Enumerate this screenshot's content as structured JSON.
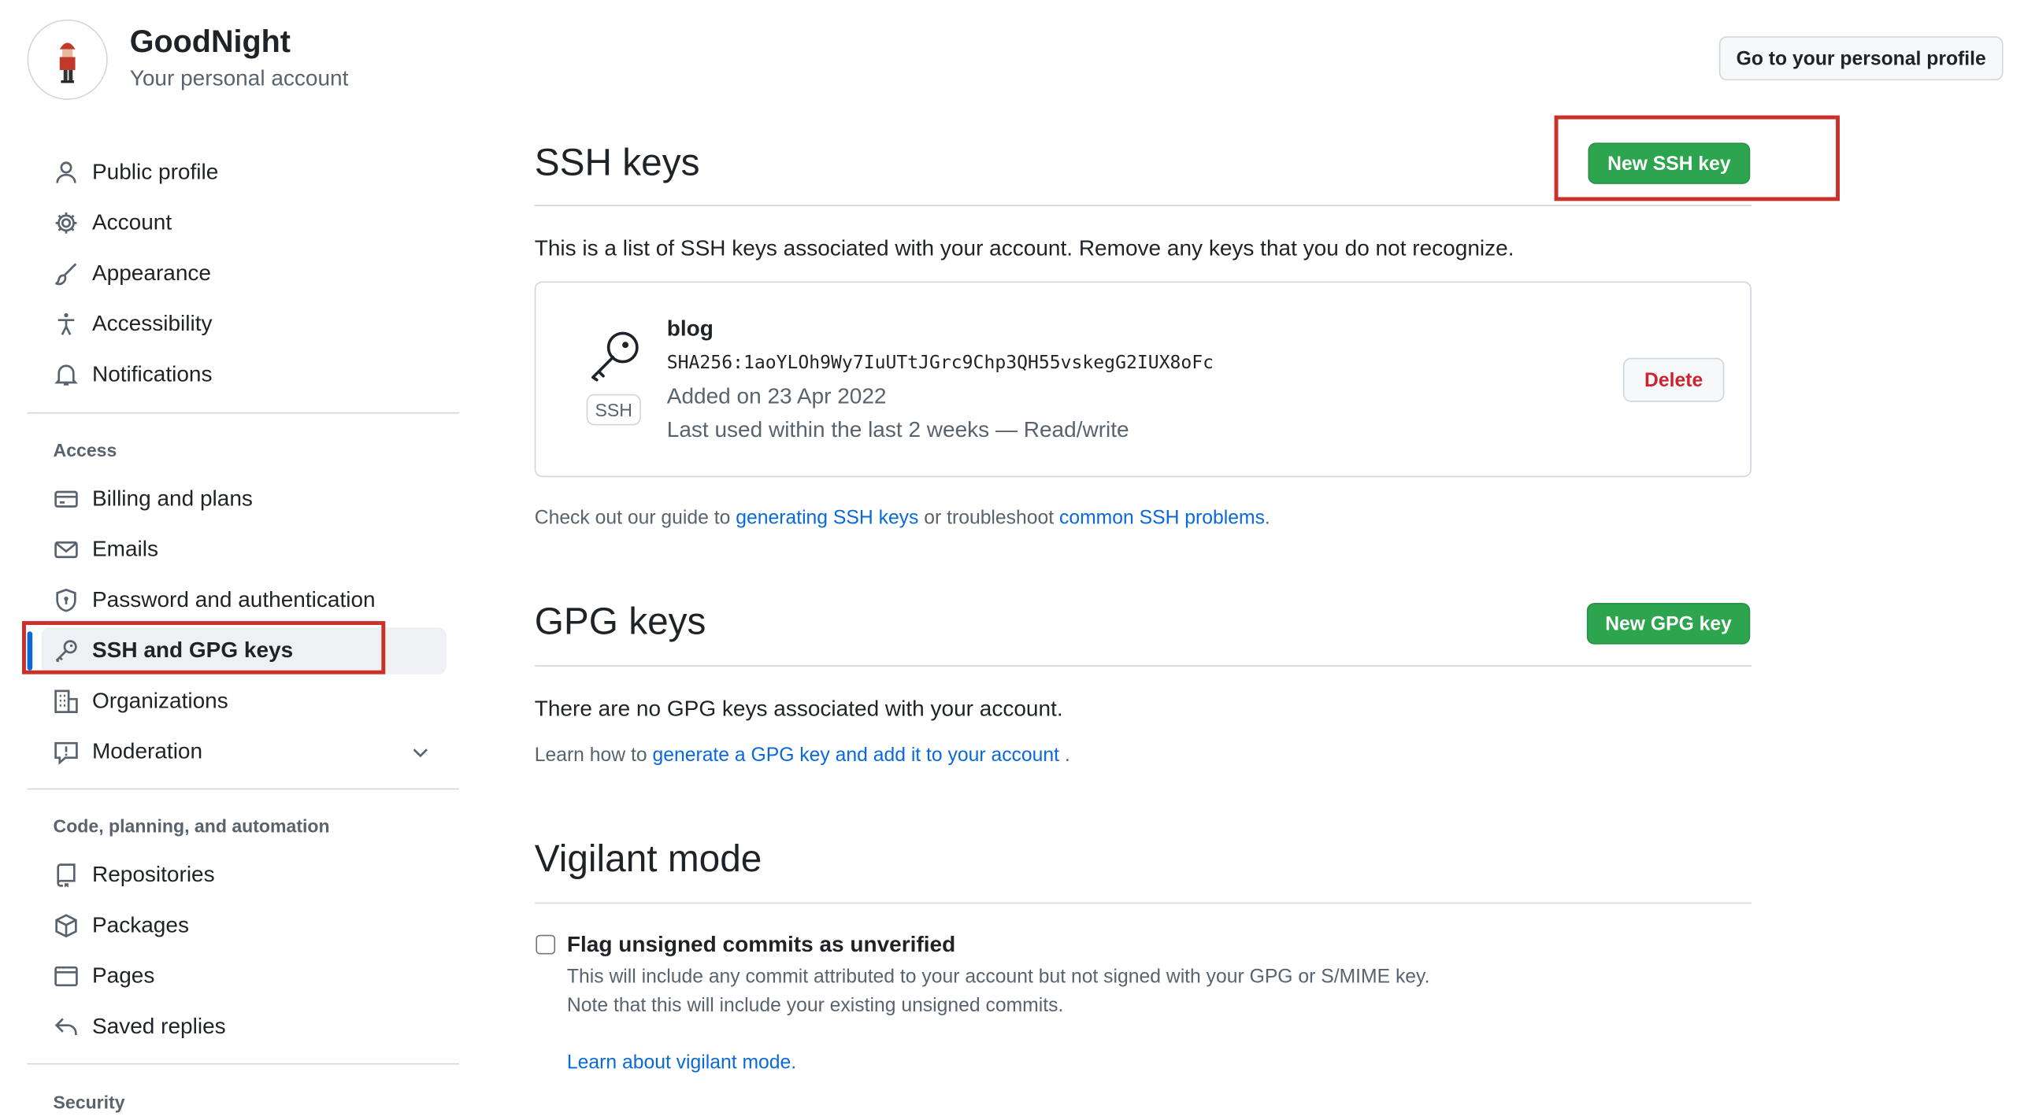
{
  "header": {
    "account_name": "GoodNight",
    "account_subtitle": "Your personal account",
    "profile_button": "Go to your personal profile"
  },
  "sidebar": {
    "items_top": [
      {
        "label": "Public profile",
        "icon": "person-icon"
      },
      {
        "label": "Account",
        "icon": "gear-icon"
      },
      {
        "label": "Appearance",
        "icon": "paintbrush-icon"
      },
      {
        "label": "Accessibility",
        "icon": "accessibility-icon"
      },
      {
        "label": "Notifications",
        "icon": "bell-icon"
      }
    ],
    "access_heading": "Access",
    "items_access": [
      {
        "label": "Billing and plans",
        "icon": "credit-card-icon"
      },
      {
        "label": "Emails",
        "icon": "mail-icon"
      },
      {
        "label": "Password and authentication",
        "icon": "shield-lock-icon"
      },
      {
        "label": "SSH and GPG keys",
        "icon": "key-icon",
        "active": true
      },
      {
        "label": "Organizations",
        "icon": "organization-icon"
      },
      {
        "label": "Moderation",
        "icon": "report-icon",
        "expandable": true
      }
    ],
    "code_heading": "Code, planning, and automation",
    "items_code": [
      {
        "label": "Repositories",
        "icon": "repo-icon"
      },
      {
        "label": "Packages",
        "icon": "package-icon"
      },
      {
        "label": "Pages",
        "icon": "browser-icon"
      },
      {
        "label": "Saved replies",
        "icon": "reply-icon"
      }
    ],
    "security_heading": "Security"
  },
  "ssh": {
    "title": "SSH keys",
    "new_button": "New SSH key",
    "description": "This is a list of SSH keys associated with your account. Remove any keys that you do not recognize.",
    "key": {
      "name": "blog",
      "badge": "SSH",
      "fingerprint": "SHA256:1aoYLOh9Wy7IuUTtJGrc9Chp3QH55vskegG2IUX8oFc",
      "added": "Added on 23 Apr 2022",
      "last_used": "Last used within the last 2 weeks — Read/write",
      "delete_button": "Delete"
    },
    "guide": {
      "prefix": "Check out our guide to ",
      "link1": "generating SSH keys",
      "middle": " or troubleshoot ",
      "link2": "common SSH problems",
      "suffix": "."
    }
  },
  "gpg": {
    "title": "GPG keys",
    "new_button": "New GPG key",
    "empty_text": "There are no GPG keys associated with your account.",
    "learn": {
      "prefix": "Learn how to ",
      "link": "generate a GPG key and add it to your account",
      "suffix": " ."
    }
  },
  "vigilant": {
    "title": "Vigilant mode",
    "checkbox_label": "Flag unsigned commits as unverified",
    "checked": false,
    "desc1": "This will include any commit attributed to your account but not signed with your GPG or S/MIME key.",
    "desc2": "Note that this will include your existing unsigned commits.",
    "learn_link": "Learn about vigilant mode."
  },
  "colors": {
    "accent_link": "#0969da",
    "primary_button": "#2da44e",
    "danger": "#cf222e",
    "highlight_box": "#c8322a"
  }
}
